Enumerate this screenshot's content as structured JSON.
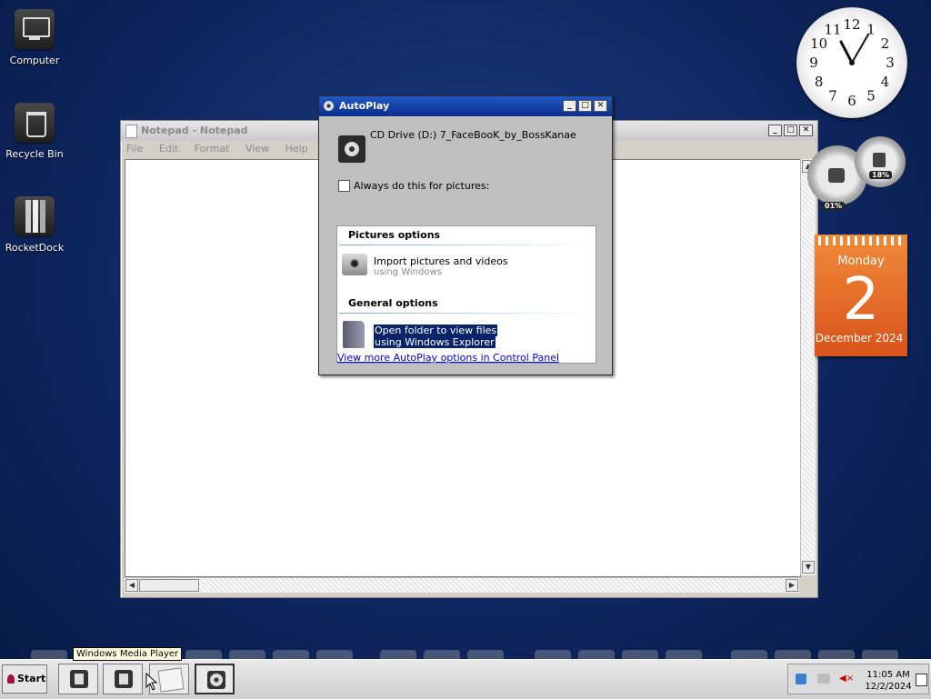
{
  "desktop": {
    "icons": [
      {
        "label": "Computer",
        "icon": "computer-icon"
      },
      {
        "label": "Recycle Bin",
        "icon": "recycle-bin-icon"
      },
      {
        "label": "RocketDock",
        "icon": "rocketdock-icon"
      }
    ]
  },
  "notepad": {
    "title": "Notepad - Notepad",
    "menu": [
      "File",
      "Edit",
      "Format",
      "View",
      "Help"
    ]
  },
  "autoplay": {
    "title": "AutoPlay",
    "drive": "CD Drive (D:) 7_FaceBooK_by_BossKanae",
    "always_label": "Always do this for pictures:",
    "pictures_header": "Pictures options",
    "import_title": "Import pictures and videos",
    "import_sub": "using Windows",
    "general_header": "General options",
    "open_line1": "Open folder to view files",
    "open_line2": "using Windows Explorer",
    "more_link": "View more AutoPlay options in Control Panel"
  },
  "clock_gadget": {
    "numbers": [
      "12",
      "1",
      "2",
      "3",
      "4",
      "5",
      "6",
      "7",
      "8",
      "9",
      "10",
      "11"
    ],
    "hour": 11,
    "minute": 5
  },
  "meter_gadget": {
    "cpu": "01%",
    "memory": "18%"
  },
  "calendar_gadget": {
    "weekday": "Monday",
    "day": "2",
    "month_year": "December 2024"
  },
  "taskbar": {
    "start_label": "Start",
    "tooltip": "Windows Media Player",
    "time": "11:05 AM",
    "date": "12/2/2024"
  },
  "colors": {
    "desktop_bg": "#0f2760",
    "titlebar_active": "#0a2e8c",
    "selection": "#0a246a",
    "calendar": "#e8702a"
  }
}
